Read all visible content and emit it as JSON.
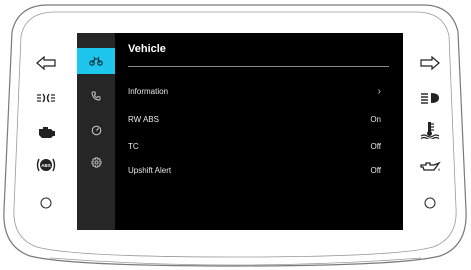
{
  "screen": {
    "title": "Vehicle",
    "menu": [
      {
        "label": "Information",
        "value": "",
        "chevron": "›"
      },
      {
        "label": "RW ABS",
        "value": "On",
        "chevron": ""
      },
      {
        "label": "TC",
        "value": "Off",
        "chevron": ""
      },
      {
        "label": "Upshift Alert",
        "value": "Off",
        "chevron": ""
      }
    ],
    "sidebar": [
      {
        "icon": "motorcycle-icon",
        "active": true
      },
      {
        "icon": "phone-icon",
        "active": false
      },
      {
        "icon": "gauge-icon",
        "active": false
      },
      {
        "icon": "gear-icon",
        "active": false
      }
    ]
  },
  "left_panel_icons": [
    "left-arrow-icon",
    "position-lights-icon",
    "engine-check-icon",
    "abs-icon",
    "home-button-icon"
  ],
  "right_panel_icons": [
    "right-arrow-icon",
    "high-beam-icon",
    "coolant-temp-icon",
    "oil-pressure-icon",
    "function-button-icon"
  ],
  "colors": {
    "accent": "#1ec6ee",
    "screen_bg": "#000000",
    "sidebar_bg": "#262626",
    "text": "#e8e8e8"
  }
}
